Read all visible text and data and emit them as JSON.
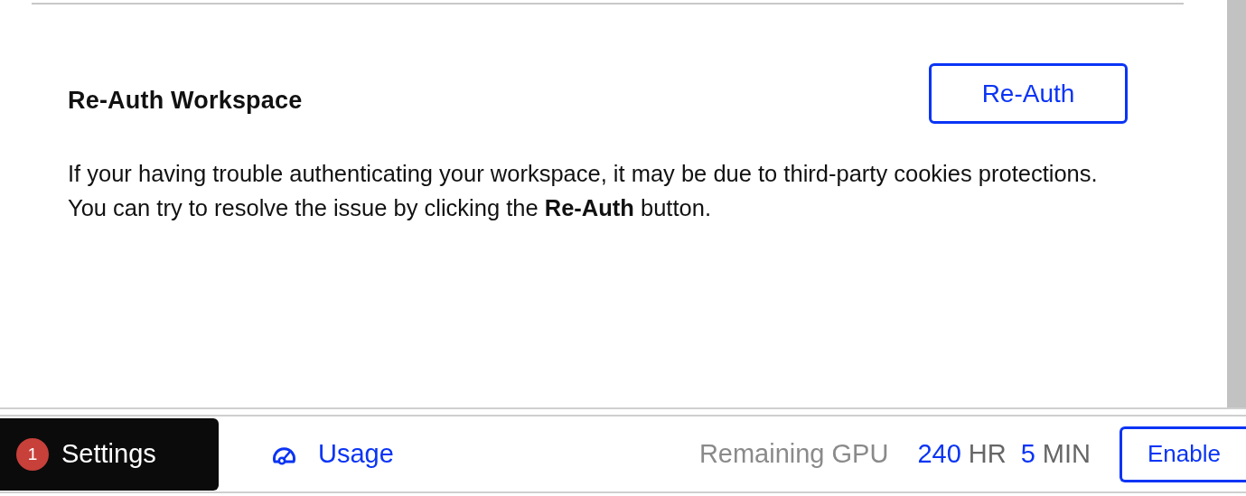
{
  "section": {
    "title": "Re-Auth Workspace",
    "button": "Re-Auth",
    "description": "If your having trouble authenticating your workspace, it may be due to third-party cookies protections. You can try to resolve the issue by clicking the **Re-Auth** button."
  },
  "bottom_bar": {
    "settings": {
      "label": "Settings",
      "badge": "1"
    },
    "usage": {
      "label": "Usage"
    },
    "gpu": {
      "label": "Remaining GPU",
      "hours": "240",
      "hours_unit": "HR",
      "minutes": "5",
      "minutes_unit": "MIN"
    },
    "enable_button": "Enable"
  }
}
